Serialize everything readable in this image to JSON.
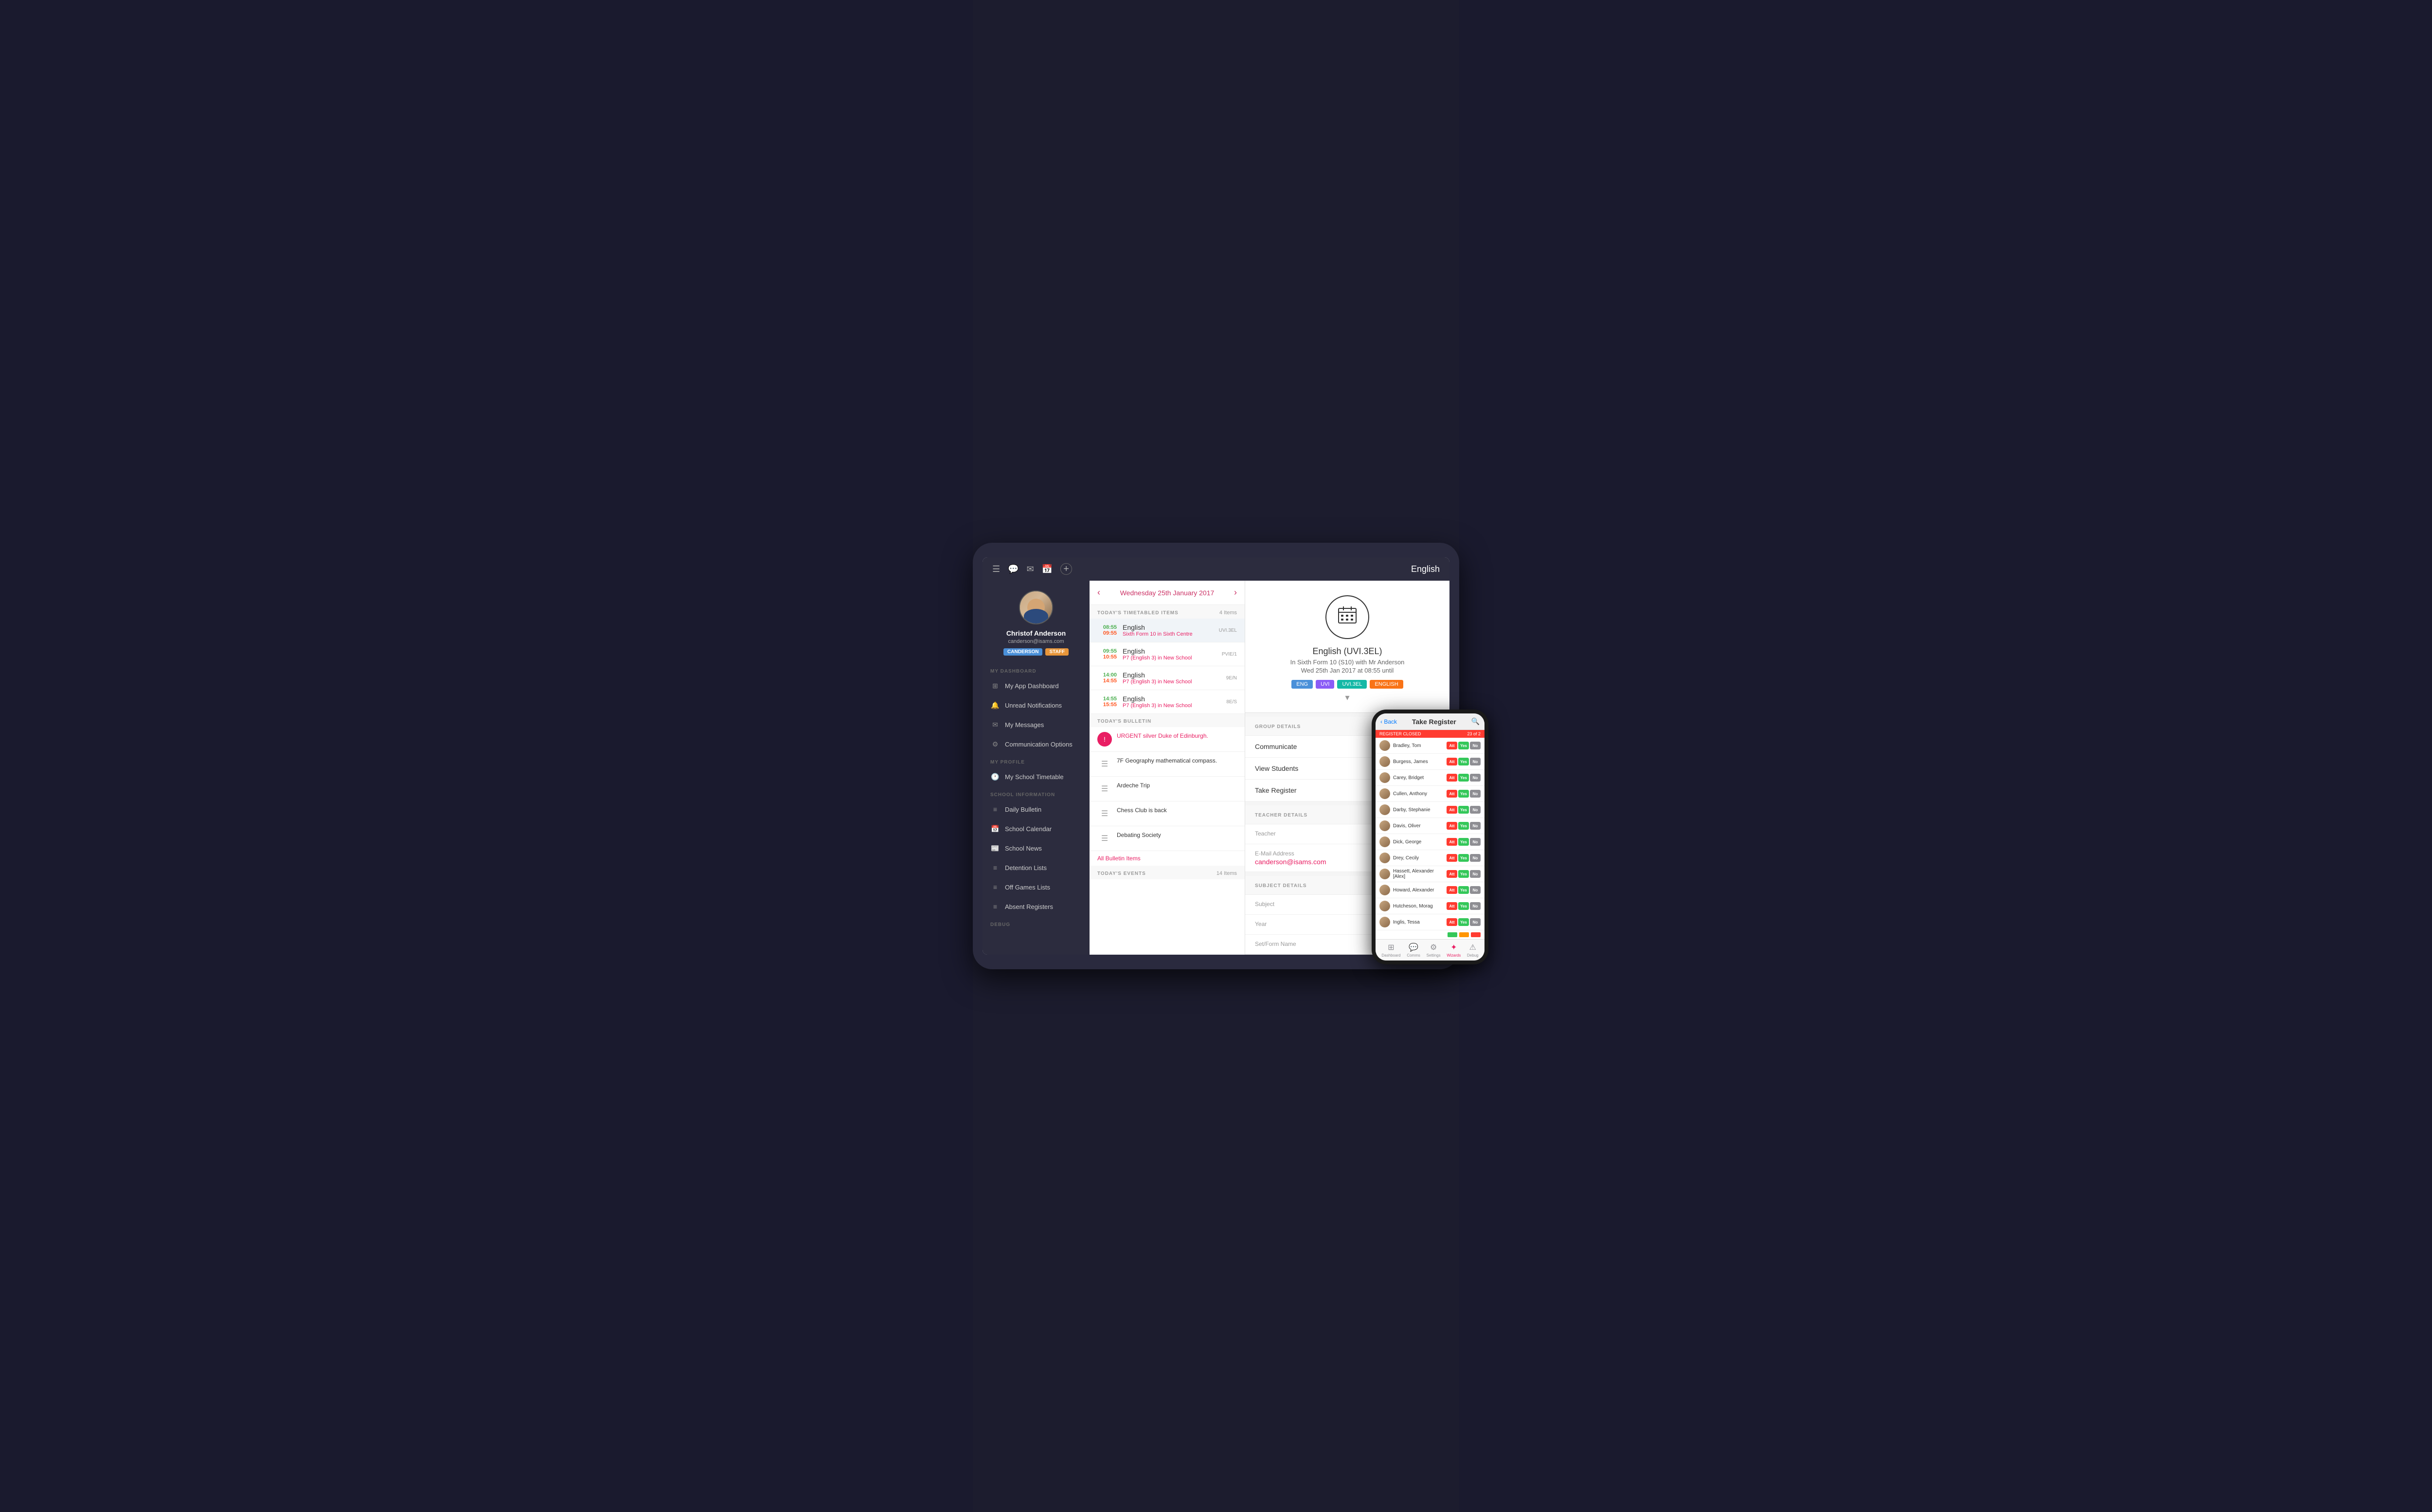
{
  "topBar": {
    "title": "English",
    "icons": [
      "menu-icon",
      "chat-icon",
      "mail-icon",
      "calendar-icon",
      "add-icon"
    ]
  },
  "sidebar": {
    "user": {
      "name": "Christof Anderson",
      "email": "canderson@isams.com",
      "badges": [
        {
          "label": "CANDERSON",
          "color": "blue"
        },
        {
          "label": "STAFF",
          "color": "orange"
        }
      ]
    },
    "sections": [
      {
        "label": "MY DASHBOARD",
        "items": [
          {
            "label": "My App Dashboard",
            "icon": "grid-icon"
          },
          {
            "label": "Unread Notifications",
            "icon": "bell-icon"
          },
          {
            "label": "My Messages",
            "icon": "message-icon"
          },
          {
            "label": "Communication Options",
            "icon": "settings-icon"
          }
        ]
      },
      {
        "label": "MY PROFILE",
        "items": [
          {
            "label": "My School Timetable",
            "icon": "clock-icon"
          }
        ]
      },
      {
        "label": "SCHOOL INFORMATION",
        "items": [
          {
            "label": "Daily Bulletin",
            "icon": "list-icon"
          },
          {
            "label": "School Calendar",
            "icon": "calendar-icon"
          },
          {
            "label": "School News",
            "icon": "news-icon"
          },
          {
            "label": "Detention Lists",
            "icon": "list-icon"
          },
          {
            "label": "Off Games Lists",
            "icon": "list-icon"
          },
          {
            "label": "Absent Registers",
            "icon": "list-icon"
          }
        ]
      },
      {
        "label": "DEBUG",
        "items": []
      }
    ]
  },
  "middlePanel": {
    "dateNav": {
      "date": "Wednesday 25th January 2017",
      "prevArrow": "‹",
      "nextArrow": "›"
    },
    "timetableSection": {
      "label": "TODAY'S TIMETABLED ITEMS",
      "count": "4 Items",
      "items": [
        {
          "startTime": "08:55",
          "endTime": "09:55",
          "subject": "English",
          "location": "Sixth Form 10 in Sixth Centre",
          "code": "UVI.3EL",
          "selected": true
        },
        {
          "startTime": "09:55",
          "endTime": "10:55",
          "subject": "English",
          "location": "P7 (English 3) in New School",
          "code": "PVIE/1",
          "selected": false
        },
        {
          "startTime": "14:00",
          "endTime": "14:55",
          "subject": "English",
          "location": "P7 (English 3) in New School",
          "code": "9E/N",
          "selected": false
        },
        {
          "startTime": "14:55",
          "endTime": "15:55",
          "subject": "English",
          "location": "P7 (English 3) in New School",
          "code": "8E/S",
          "selected": false
        }
      ]
    },
    "bulletinSection": {
      "label": "TODAY'S BULLETIN",
      "items": [
        {
          "text": "URGENT silver Duke of Edinburgh.",
          "urgent": true
        },
        {
          "text": "7F Geography mathematical compass.",
          "urgent": false
        },
        {
          "text": "Ardeche Trip",
          "urgent": false
        },
        {
          "text": "Chess Club is back",
          "urgent": false
        },
        {
          "text": "Debating Society",
          "urgent": false
        }
      ],
      "allItemsLink": "All Bulletin Items"
    },
    "eventsSection": {
      "label": "TODAY'S EVENTS",
      "count": "14 Items"
    }
  },
  "rightPanel": {
    "detail": {
      "title": "English (UVI.3EL)",
      "subtitle": "In Sixth Form 10 (S10) with Mr Anderson",
      "date": "Wed 25th Jan 2017 at 08:55 until",
      "tags": [
        {
          "label": "ENG",
          "color": "blue"
        },
        {
          "label": "UVI",
          "color": "purple"
        },
        {
          "label": "UVI.3EL",
          "color": "teal"
        },
        {
          "label": "ENGLISH",
          "color": "orange"
        }
      ]
    },
    "groupDetails": {
      "sectionLabel": "GROUP DETAILS",
      "actions": [
        {
          "label": "Communicate"
        },
        {
          "label": "View Students"
        },
        {
          "label": "Take Register"
        }
      ]
    },
    "teacherDetails": {
      "sectionLabel": "TEACHER DETAILS",
      "fields": [
        {
          "label": "Teacher",
          "value": ""
        },
        {
          "label": "E-Mail Address",
          "value": "canderson@isams.com",
          "isLink": true
        }
      ]
    },
    "subjectDetails": {
      "sectionLabel": "SUBJECT DETAILS",
      "fields": [
        {
          "label": "Subject",
          "value": ""
        },
        {
          "label": "Year",
          "value": ""
        },
        {
          "label": "Set/Form Name",
          "value": ""
        }
      ]
    }
  },
  "phone": {
    "topBar": {
      "back": "Back",
      "title": "Take Register",
      "icon": "search"
    },
    "registerStatus": {
      "text": "REGISTER CLOSED",
      "count": "23 of 2"
    },
    "students": [
      {
        "name": "Bradley, Tom",
        "buttons": [
          "Att",
          "Yes",
          "No"
        ]
      },
      {
        "name": "Burgess, James",
        "buttons": [
          "Att",
          "Yes",
          "No"
        ]
      },
      {
        "name": "Carey, Bridget",
        "buttons": [
          "Att",
          "Yes",
          "No"
        ]
      },
      {
        "name": "Cullen, Anthony",
        "buttons": [
          "Att",
          "Yes",
          "No"
        ]
      },
      {
        "name": "Darby, Stephanie",
        "buttons": [
          "Att",
          "Yes",
          "No"
        ]
      },
      {
        "name": "Davis, Oliver",
        "buttons": [
          "Att",
          "Yes",
          "No"
        ]
      },
      {
        "name": "Dick, George",
        "buttons": [
          "Att",
          "Yes",
          "No"
        ]
      },
      {
        "name": "Drey, Cecily",
        "buttons": [
          "Att",
          "Yes",
          "No"
        ]
      },
      {
        "name": "Hassett, Alexander [Alex]",
        "buttons": [
          "Att",
          "Yes",
          "No"
        ]
      },
      {
        "name": "Howard, Alexander",
        "buttons": [
          "Att",
          "Yes",
          "No"
        ]
      },
      {
        "name": "Hutcheson, Morag",
        "buttons": [
          "Att",
          "Yes",
          "No"
        ]
      },
      {
        "name": "Inglis, Tessa",
        "buttons": [
          "Att",
          "Yes",
          "No"
        ]
      }
    ],
    "legend": [
      {
        "color": "#34c759"
      },
      {
        "color": "#ff9500"
      },
      {
        "color": "#ff3b30"
      }
    ],
    "bottomTabs": [
      {
        "label": "Dashboard",
        "icon": "⊞",
        "active": false
      },
      {
        "label": "Comms",
        "icon": "💬",
        "active": false
      },
      {
        "label": "Settings",
        "icon": "⚙",
        "active": false
      },
      {
        "label": "Wizards",
        "icon": "✦",
        "active": true
      },
      {
        "label": "Debug",
        "icon": "⚠",
        "active": false
      }
    ]
  }
}
